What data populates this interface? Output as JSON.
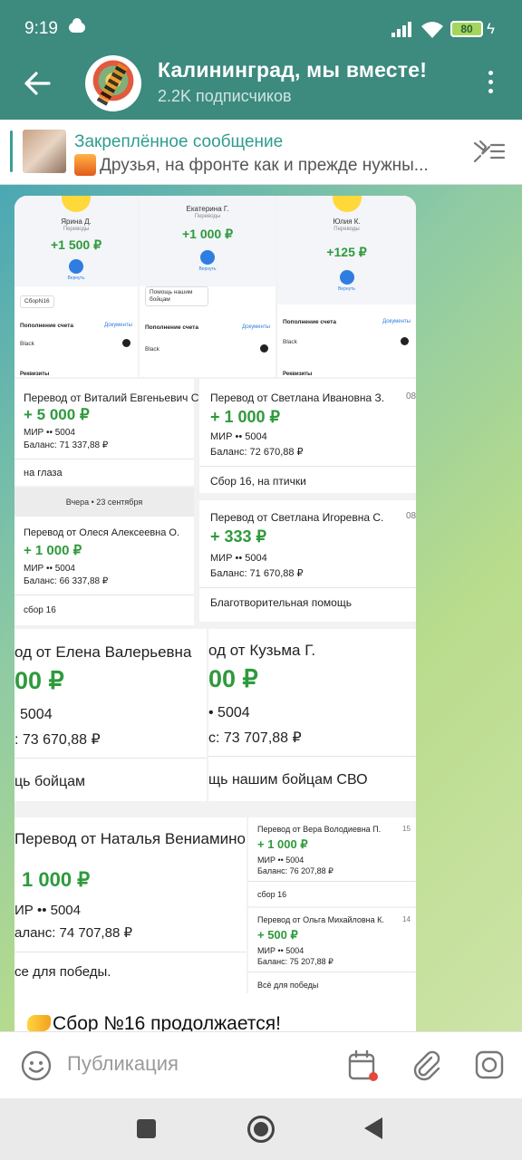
{
  "status": {
    "time": "9:19",
    "battery": "80"
  },
  "header": {
    "title": "Калининград, мы вместе!",
    "subtitle": "2.2K подписчиков"
  },
  "pinned": {
    "title": "Закреплённое сообщение",
    "text": "Друзья, на фронте как и прежде нужны..."
  },
  "receipts": [
    {
      "name": "Ярина Д.",
      "status": "Переводы",
      "amount": "+1 500 ₽",
      "button": "Вернуть",
      "note": "СборN16",
      "ops": "Пополнение счета",
      "docs": "Документы",
      "card": "Black",
      "req": "Реквизиты"
    },
    {
      "name": "Екатерина Г.",
      "status": "Переводы",
      "amount": "+1 000 ₽",
      "button": "Вернуть",
      "note": "Помощь нашим бойцам",
      "ops": "Пополнение счета",
      "docs": "Документы",
      "card": "Black",
      "req": ""
    },
    {
      "name": "Юлия К.",
      "status": "Переводы",
      "amount": "+125 ₽",
      "button": "Вернуть",
      "note": "",
      "ops": "Пополнение счета",
      "docs": "Документы",
      "card": "Black",
      "req": "Реквизиты"
    }
  ],
  "transfers": [
    {
      "head": "Перевод от Виталий Евгеньевич С.",
      "amount": "+ 5 000 ₽",
      "card": "МИР •• 5004",
      "balance": "Баланс: 71 337,88 ₽",
      "note": "на глаза",
      "time": ""
    },
    {
      "head": "Перевод от Светлана Ивановна З.",
      "amount": "+ 1 000 ₽",
      "card": "МИР •• 5004",
      "balance": "Баланс: 72 670,88 ₽",
      "note": "Сбор  16, на птички",
      "time": "08"
    },
    {
      "head": "Перевод от Олеся Алексеевна О.",
      "amount": "+ 1 000 ₽",
      "card": "МИР •• 5004",
      "balance": "Баланс: 66 337,88 ₽",
      "note": "сбор 16",
      "time": ""
    },
    {
      "head": "Перевод от Светлана Игоревна С.",
      "amount": "+ 333 ₽",
      "card": "МИР •• 5004",
      "balance": "Баланс: 71 670,88 ₽",
      "note": "Благотворительная помощь",
      "time": "08"
    },
    {
      "head": "од от Елена Валерьевна",
      "amount": "00 ₽",
      "card": "5004",
      "balance": ": 73 670,88 ₽",
      "note": "ць бойцам",
      "time": ""
    },
    {
      "head": "од от Кузьма Г.",
      "amount": "00 ₽",
      "card": "• 5004",
      "balance": "с: 73 707,88 ₽",
      "note": "щь нашим бойцам СВО",
      "time": ""
    },
    {
      "head": "Перевод от Наталья Вениаминовна",
      "amount": "1 000 ₽",
      "card": "ИР •• 5004",
      "balance": "аланс: 74 707,88 ₽",
      "note": "се для победы.",
      "time": ""
    },
    {
      "head": "Перевод от Вера Володиевна П.",
      "amount": "+ 1 000 ₽",
      "card": "МИР •• 5004",
      "balance": "Баланс: 76 207,88 ₽",
      "note": "сбор 16",
      "time": "15"
    },
    {
      "head": "Перевод от Ольга Михайловна К.",
      "amount": "+ 500 ₽",
      "card": "МИР •• 5004",
      "balance": "Баланс: 75 207,88 ₽",
      "note": "Всё для победы",
      "time": "14"
    }
  ],
  "day_separator": "Вчера • 23 сентября",
  "caption": "Сбор №16 продолжается!",
  "composer": {
    "placeholder": "Публикация"
  },
  "icons": [
    "back-icon",
    "menu-icon",
    "unpin-icon",
    "emoji-icon",
    "calendar-icon",
    "attach-icon",
    "camera-icon"
  ],
  "colors": {
    "header": "#3d8a7f",
    "accent": "#2e9d8f",
    "money": "#2e9a3c"
  }
}
